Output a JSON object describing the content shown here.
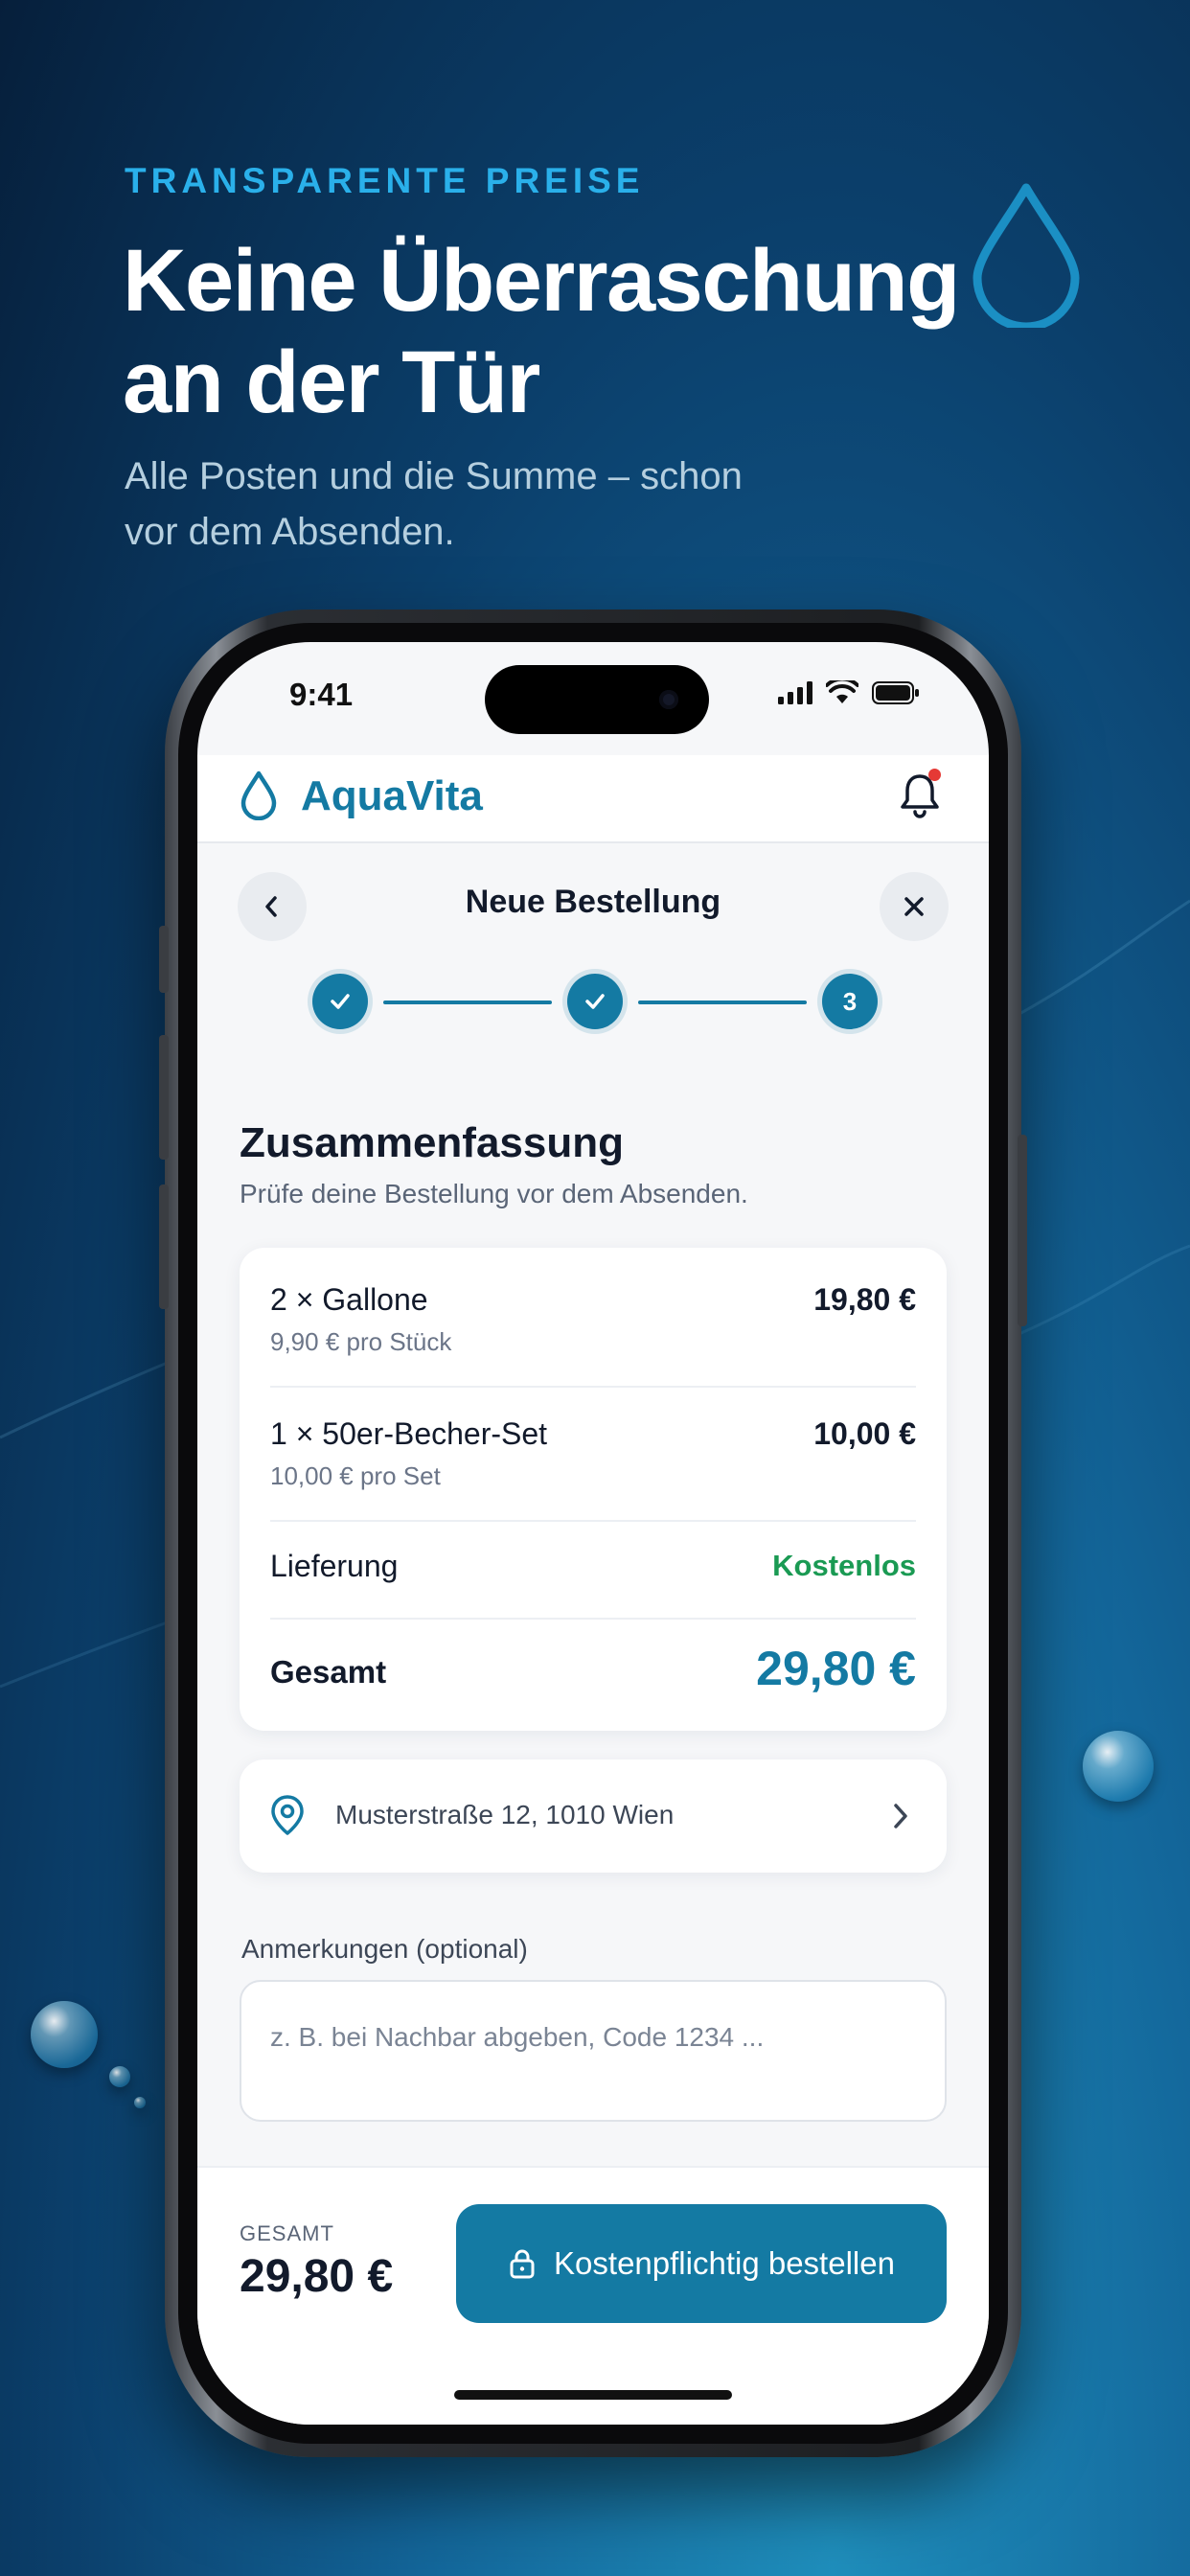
{
  "hero": {
    "eyebrow": "TRANSPARENTE PREISE",
    "headline": "Keine Überraschung an der Tür",
    "subline": "Alle Posten und die Summe – schon vor dem Absenden."
  },
  "status_bar": {
    "time": "9:41"
  },
  "app": {
    "brand": "AquaVita",
    "brand_color": "#147aa3",
    "notification_dot_color": "#e53935"
  },
  "nav": {
    "title": "Neue Bestellung",
    "back_icon": "chevron-left-icon",
    "close_icon": "close-icon"
  },
  "stepper": {
    "steps": [
      {
        "state": "done"
      },
      {
        "state": "done"
      },
      {
        "state": "current",
        "label": "3"
      }
    ]
  },
  "summary": {
    "title": "Zusammenfassung",
    "subtitle": "Prüfe deine Bestellung vor dem Absenden.",
    "items": [
      {
        "name": "2 × Gallone",
        "unit_price": "9,90 € pro Stück",
        "price": "19,80 €"
      },
      {
        "name": "1 × 50er-Becher-Set",
        "unit_price": "10,00 € pro Set",
        "price": "10,00 €"
      }
    ],
    "delivery_label": "Lieferung",
    "delivery_value": "Kostenlos",
    "total_label": "Gesamt",
    "total_value": "29,80 €"
  },
  "address": {
    "text": "Musterstraße 12, 1010 Wien"
  },
  "notes": {
    "label": "Anmerkungen (optional)",
    "placeholder": "z. B. bei Nachbar abgeben, Code 1234 ..."
  },
  "footer": {
    "total_caption": "GESAMT",
    "total_value": "29,80 €",
    "order_button": "Kostenpflichtig bestellen"
  }
}
